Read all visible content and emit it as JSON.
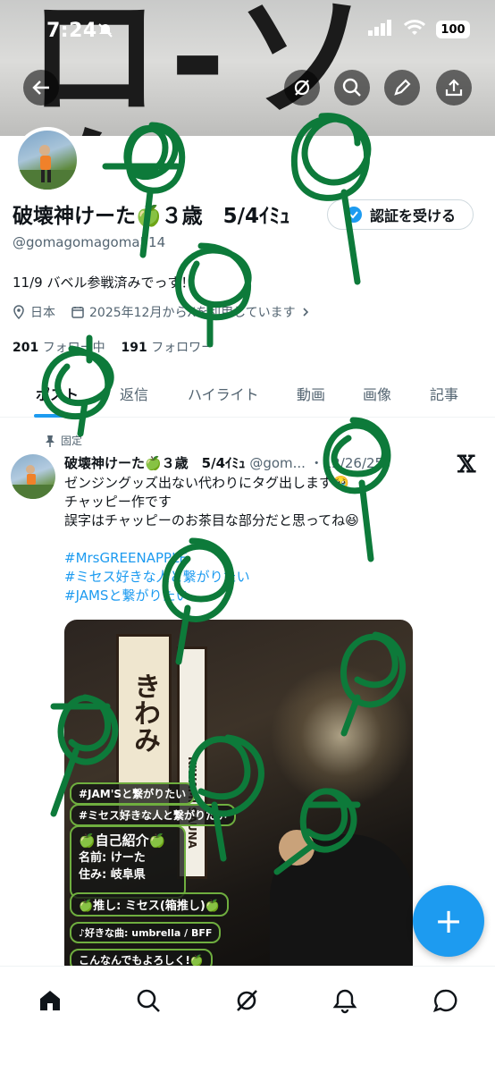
{
  "status_bar": {
    "time": "7:24",
    "battery": "100"
  },
  "profile": {
    "name": "破壊神けーた🍏３歳　5/4ｲﾐｭ",
    "handle": "@gomagomagoma514",
    "verify_label": "認証を受ける",
    "bio": "11/9 バベル参戦済みでっす！",
    "location": "日本",
    "joined": "2025年12月からXを利用しています",
    "following_count": "201",
    "following_label": "フォロー中",
    "followers_count": "191",
    "followers_label": "フォロワー"
  },
  "tabs": [
    {
      "label": "ポスト",
      "active": true
    },
    {
      "label": "返信"
    },
    {
      "label": "ハイライト"
    },
    {
      "label": "動画"
    },
    {
      "label": "画像"
    },
    {
      "label": "記事"
    }
  ],
  "post": {
    "pinned_label": "固定",
    "author_name": "破壊神けーた🍏３歳　5/4ｲﾐｭ",
    "author_handle": "@gom...",
    "date": "・12/26/25",
    "lines": [
      "ゼンジングッズ出ない代わりにタグ出します🥹",
      "チャッピー作です",
      "誤字はチャッピーのお茶目な部分だと思ってね😆",
      ""
    ],
    "hashtags": [
      "#MrsGREENAPPLE",
      "#ミセス好きな人と繋がりたい",
      "#JAMSと繋がりたい"
    ],
    "image": {
      "sign_text_1": "きわみ",
      "sign_text_2": "KIWAMI SAUNA",
      "cards": [
        "#JAM'Sと繋がりたい",
        "#ミセス好きな人と繋がりたい",
        "🍏自己紹介🍏",
        "名前: けーた",
        "住み: 岐阜県",
        "🍏推し: ミセス(箱推し)🍏",
        "♪好きな曲: umbrella / BFF",
        "こんなんでもよろしく!🍏"
      ]
    }
  },
  "fab_label": "+",
  "nav": [
    "home-icon",
    "search-icon",
    "grok-icon",
    "notifications-icon",
    "messages-icon"
  ],
  "colors": {
    "accent": "#1d9bf0",
    "scribble": "#0d7a3a",
    "text": "#0f1419",
    "muted": "#536471"
  }
}
